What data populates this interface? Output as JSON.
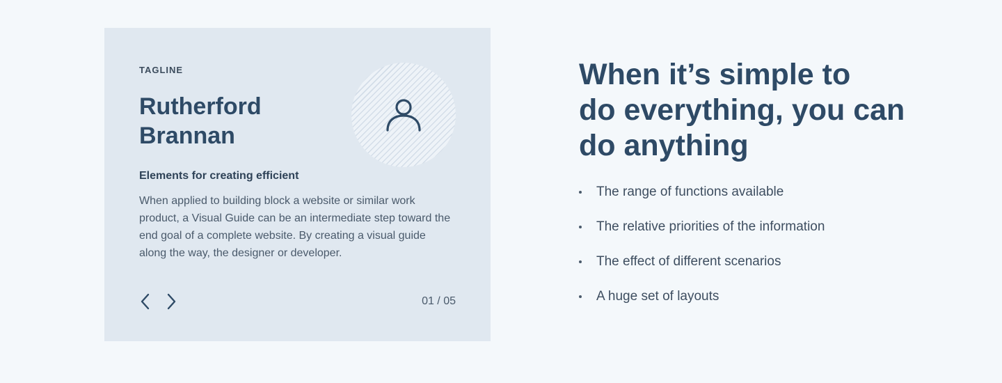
{
  "card": {
    "tagline": "TAGLINE",
    "name_line1": "Rutherford",
    "name_line2": "Brannan",
    "avatar_icon": "user-icon",
    "subheading": "Elements for creating efficient",
    "body": "When applied to building block a website or similar work product, a Visual Guide can be an intermediate step toward the end goal of a complete website. By creating a visual guide along the way, the designer or developer.",
    "prev_icon": "chevron-left-icon",
    "next_icon": "chevron-right-icon",
    "pagination": "01 / 05"
  },
  "hero": {
    "headline_line1": "When it’s simple to",
    "headline_line2": "do everything, you can",
    "headline_line3": "do anything"
  },
  "features": [
    "The range of functions available",
    "The relative priorities of the information",
    "The effect of different scenarios",
    "A huge set of layouts"
  ],
  "colors": {
    "page_background": "#f4f8fb",
    "card_background": "#e0e8f0",
    "heading": "#2e4a66",
    "body_text": "#4a5a6b"
  }
}
